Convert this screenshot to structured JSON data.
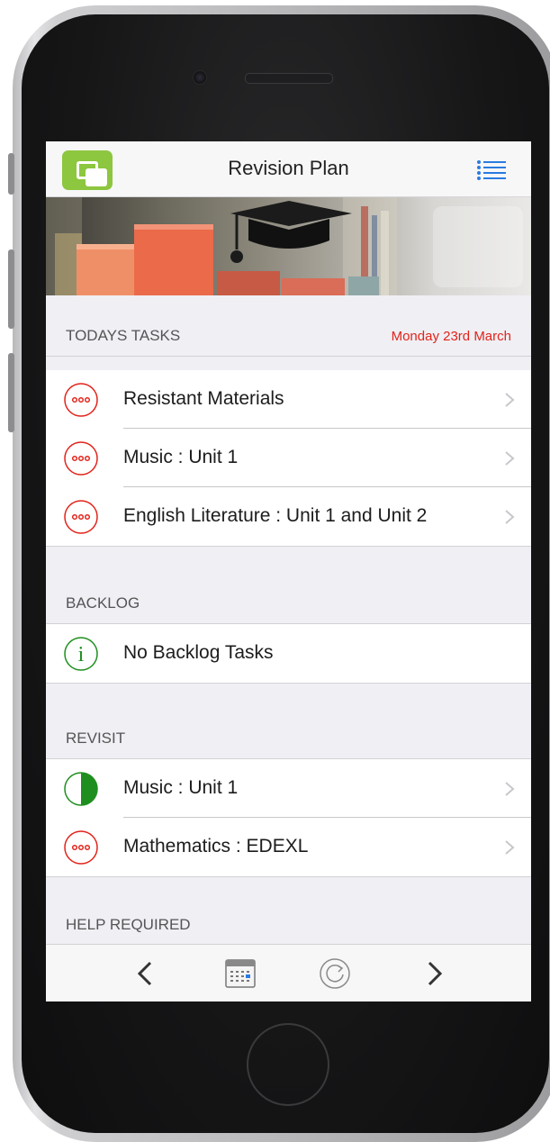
{
  "header": {
    "title": "Revision Plan"
  },
  "sections": {
    "todays_tasks": {
      "label": "TODAYS TASKS",
      "date": "Monday 23rd March",
      "items": [
        {
          "label": "Resistant Materials",
          "icon": "ellipsis-circle-icon"
        },
        {
          "label": "Music : Unit 1",
          "icon": "ellipsis-circle-icon"
        },
        {
          "label": "English Literature : Unit 1 and Unit 2",
          "icon": "ellipsis-circle-icon"
        }
      ]
    },
    "backlog": {
      "label": "BACKLOG",
      "items": [
        {
          "label": "No Backlog Tasks",
          "icon": "info-circle-icon"
        }
      ]
    },
    "revisit": {
      "label": "REVISIT",
      "items": [
        {
          "label": "Music : Unit 1",
          "icon": "half-circle-icon"
        },
        {
          "label": "Mathematics : EDEXL",
          "icon": "ellipsis-circle-icon"
        }
      ]
    },
    "help_required": {
      "label": "HELP REQUIRED"
    }
  },
  "colors": {
    "accent": "#2a7be0",
    "pending": "#e2231a",
    "complete": "#1e8f1e",
    "logo": "#8dc63f"
  }
}
